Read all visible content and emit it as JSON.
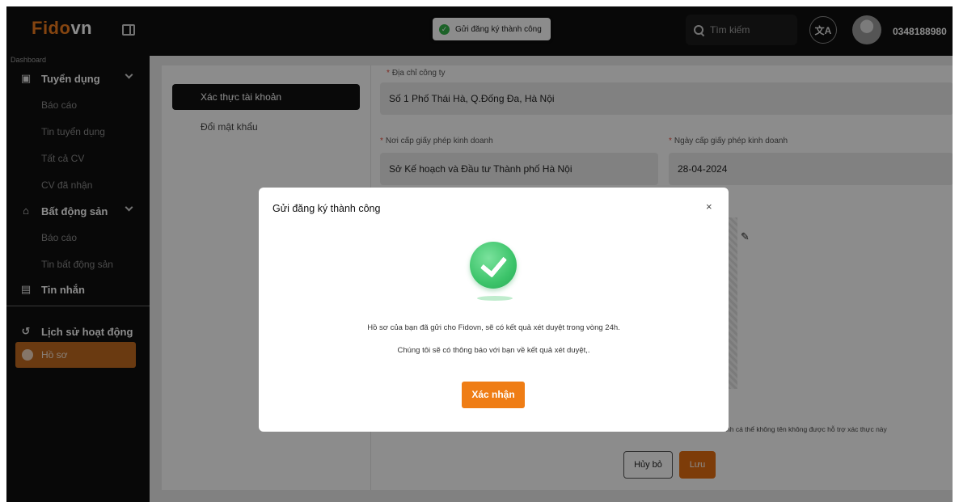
{
  "app": {
    "logo_main": "Fido",
    "logo_accent": "vn",
    "brand_color": "#f07d1e"
  },
  "toast": {
    "text": "Gửi đăng ký thành công",
    "icon": "check-circle-icon",
    "color": "#34b34a"
  },
  "header": {
    "search_placeholder": "Tìm kiếm",
    "translate_icon_text": "文A",
    "phone": "0348188980"
  },
  "sidebar": {
    "section": "Dashboard",
    "groups": [
      {
        "label": "Tuyển dụng",
        "icon": "briefcase-icon",
        "children": [
          "Báo cáo",
          "Tin tuyển dụng",
          "Tất cả CV",
          "CV đã nhận"
        ]
      },
      {
        "label": "Bất động sản",
        "icon": "house-icon",
        "children": [
          "Báo cáo",
          "Tin bất động sản"
        ]
      },
      {
        "label": "Tin nhắn",
        "icon": "message-icon"
      }
    ],
    "history": "Lịch sử hoạt động",
    "active": "Hồ sơ",
    "active_color": "#c26a1f"
  },
  "profile_nav": {
    "active": "Xác thực tài khoản",
    "item": "Đổi mật khẩu"
  },
  "form": {
    "address_label": "Địa chỉ công ty",
    "address_value": "Số 1 Phố Thái Hà, Q.Đống Đa, Hà Nội",
    "license_place_label": "Nơi cấp giấy phép kinh doanh",
    "license_place_value": "Sở Kế hoạch và Đầu tư Thành phố Hà Nội",
    "license_date_label": "Ngày cấp giấy phép kinh doanh",
    "license_date_value": "28-04-2024",
    "note": "nh cá thể không tên không được hỗ trợ xác thực này",
    "cancel": "Hủy bỏ",
    "save": "Lưu"
  },
  "modal": {
    "title": "Gửi đăng ký thành công",
    "close": "×",
    "message_1": "Hồ sơ của bạn đã gửi cho Fidovn, sẽ có kết quả xét duyệt trong vòng 24h.",
    "message_2": "Chúng tôi sẽ có thông báo với bạn về kết quả xét duyệt,.",
    "confirm": "Xác nhận",
    "confirm_color": "#ef7d15"
  }
}
